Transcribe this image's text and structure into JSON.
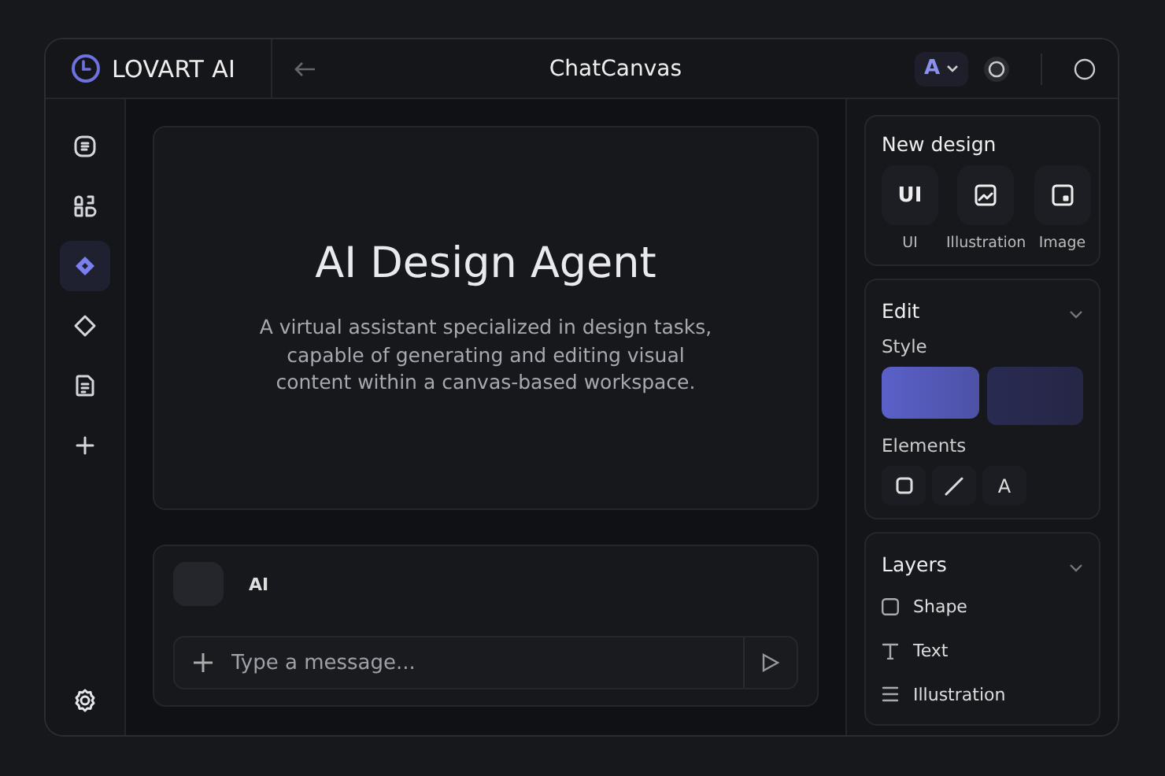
{
  "app": {
    "name": "LOVART AI"
  },
  "header": {
    "title": "ChatCanvas",
    "avatar_letter": "A"
  },
  "sidebar": {
    "items": [
      {
        "kind": "document",
        "selected": false
      },
      {
        "kind": "shapes",
        "selected": false
      },
      {
        "kind": "diamond-filled",
        "selected": true
      },
      {
        "kind": "diamond",
        "selected": false
      },
      {
        "kind": "file",
        "selected": false
      },
      {
        "kind": "plus",
        "selected": false
      }
    ]
  },
  "hero": {
    "title": "AI Design Agent",
    "description": "A virtual assistant specialized in design tasks,\ncapable of generating and editing visual\ncontent within a canvas-based workspace."
  },
  "chat": {
    "sender": "AI",
    "input": {
      "placeholder": "Type a message..."
    }
  },
  "panel": {
    "new_design": {
      "title": "New design",
      "items": [
        {
          "kind": "text",
          "glyph": "UI",
          "label": "UI"
        },
        {
          "kind": "illustration",
          "label": "Illustration"
        },
        {
          "kind": "image",
          "label": "Image"
        }
      ]
    },
    "edit": {
      "title": "Edit",
      "expanded": true,
      "style_label": "Style",
      "styles": [
        {
          "color": "#5a60c8",
          "selected": true
        },
        {
          "color": "#2e2f5e",
          "selected": false
        }
      ],
      "elements_label": "Elements",
      "tools": [
        {
          "kind": "rectangle"
        },
        {
          "kind": "line"
        },
        {
          "kind": "text",
          "glyph": "A"
        }
      ]
    },
    "layers": {
      "title": "Layers",
      "expanded": true,
      "items": [
        {
          "kind": "shape",
          "label": "Shape"
        },
        {
          "kind": "text",
          "label": "Text"
        },
        {
          "kind": "list",
          "label": "Illustration"
        }
      ]
    }
  }
}
